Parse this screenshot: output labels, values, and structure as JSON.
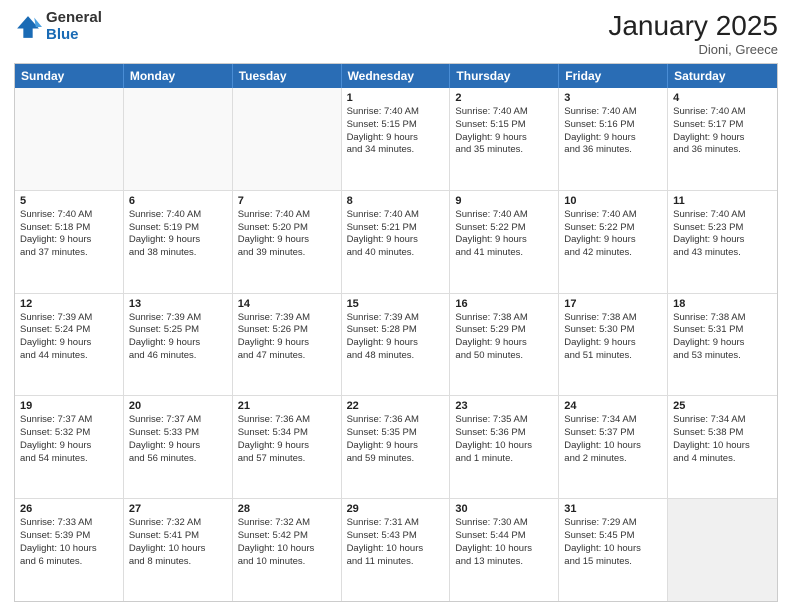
{
  "header": {
    "logo": {
      "general": "General",
      "blue": "Blue"
    },
    "title": "January 2025",
    "location": "Dioni, Greece"
  },
  "days_of_week": [
    "Sunday",
    "Monday",
    "Tuesday",
    "Wednesday",
    "Thursday",
    "Friday",
    "Saturday"
  ],
  "weeks": [
    [
      {
        "day": "",
        "info": "",
        "empty": true
      },
      {
        "day": "",
        "info": "",
        "empty": true
      },
      {
        "day": "",
        "info": "",
        "empty": true
      },
      {
        "day": "1",
        "info": "Sunrise: 7:40 AM\nSunset: 5:15 PM\nDaylight: 9 hours\nand 34 minutes."
      },
      {
        "day": "2",
        "info": "Sunrise: 7:40 AM\nSunset: 5:15 PM\nDaylight: 9 hours\nand 35 minutes."
      },
      {
        "day": "3",
        "info": "Sunrise: 7:40 AM\nSunset: 5:16 PM\nDaylight: 9 hours\nand 36 minutes."
      },
      {
        "day": "4",
        "info": "Sunrise: 7:40 AM\nSunset: 5:17 PM\nDaylight: 9 hours\nand 36 minutes."
      }
    ],
    [
      {
        "day": "5",
        "info": "Sunrise: 7:40 AM\nSunset: 5:18 PM\nDaylight: 9 hours\nand 37 minutes."
      },
      {
        "day": "6",
        "info": "Sunrise: 7:40 AM\nSunset: 5:19 PM\nDaylight: 9 hours\nand 38 minutes."
      },
      {
        "day": "7",
        "info": "Sunrise: 7:40 AM\nSunset: 5:20 PM\nDaylight: 9 hours\nand 39 minutes."
      },
      {
        "day": "8",
        "info": "Sunrise: 7:40 AM\nSunset: 5:21 PM\nDaylight: 9 hours\nand 40 minutes."
      },
      {
        "day": "9",
        "info": "Sunrise: 7:40 AM\nSunset: 5:22 PM\nDaylight: 9 hours\nand 41 minutes."
      },
      {
        "day": "10",
        "info": "Sunrise: 7:40 AM\nSunset: 5:22 PM\nDaylight: 9 hours\nand 42 minutes."
      },
      {
        "day": "11",
        "info": "Sunrise: 7:40 AM\nSunset: 5:23 PM\nDaylight: 9 hours\nand 43 minutes."
      }
    ],
    [
      {
        "day": "12",
        "info": "Sunrise: 7:39 AM\nSunset: 5:24 PM\nDaylight: 9 hours\nand 44 minutes."
      },
      {
        "day": "13",
        "info": "Sunrise: 7:39 AM\nSunset: 5:25 PM\nDaylight: 9 hours\nand 46 minutes."
      },
      {
        "day": "14",
        "info": "Sunrise: 7:39 AM\nSunset: 5:26 PM\nDaylight: 9 hours\nand 47 minutes."
      },
      {
        "day": "15",
        "info": "Sunrise: 7:39 AM\nSunset: 5:28 PM\nDaylight: 9 hours\nand 48 minutes."
      },
      {
        "day": "16",
        "info": "Sunrise: 7:38 AM\nSunset: 5:29 PM\nDaylight: 9 hours\nand 50 minutes."
      },
      {
        "day": "17",
        "info": "Sunrise: 7:38 AM\nSunset: 5:30 PM\nDaylight: 9 hours\nand 51 minutes."
      },
      {
        "day": "18",
        "info": "Sunrise: 7:38 AM\nSunset: 5:31 PM\nDaylight: 9 hours\nand 53 minutes."
      }
    ],
    [
      {
        "day": "19",
        "info": "Sunrise: 7:37 AM\nSunset: 5:32 PM\nDaylight: 9 hours\nand 54 minutes."
      },
      {
        "day": "20",
        "info": "Sunrise: 7:37 AM\nSunset: 5:33 PM\nDaylight: 9 hours\nand 56 minutes."
      },
      {
        "day": "21",
        "info": "Sunrise: 7:36 AM\nSunset: 5:34 PM\nDaylight: 9 hours\nand 57 minutes."
      },
      {
        "day": "22",
        "info": "Sunrise: 7:36 AM\nSunset: 5:35 PM\nDaylight: 9 hours\nand 59 minutes."
      },
      {
        "day": "23",
        "info": "Sunrise: 7:35 AM\nSunset: 5:36 PM\nDaylight: 10 hours\nand 1 minute."
      },
      {
        "day": "24",
        "info": "Sunrise: 7:34 AM\nSunset: 5:37 PM\nDaylight: 10 hours\nand 2 minutes."
      },
      {
        "day": "25",
        "info": "Sunrise: 7:34 AM\nSunset: 5:38 PM\nDaylight: 10 hours\nand 4 minutes."
      }
    ],
    [
      {
        "day": "26",
        "info": "Sunrise: 7:33 AM\nSunset: 5:39 PM\nDaylight: 10 hours\nand 6 minutes."
      },
      {
        "day": "27",
        "info": "Sunrise: 7:32 AM\nSunset: 5:41 PM\nDaylight: 10 hours\nand 8 minutes."
      },
      {
        "day": "28",
        "info": "Sunrise: 7:32 AM\nSunset: 5:42 PM\nDaylight: 10 hours\nand 10 minutes."
      },
      {
        "day": "29",
        "info": "Sunrise: 7:31 AM\nSunset: 5:43 PM\nDaylight: 10 hours\nand 11 minutes."
      },
      {
        "day": "30",
        "info": "Sunrise: 7:30 AM\nSunset: 5:44 PM\nDaylight: 10 hours\nand 13 minutes."
      },
      {
        "day": "31",
        "info": "Sunrise: 7:29 AM\nSunset: 5:45 PM\nDaylight: 10 hours\nand 15 minutes."
      },
      {
        "day": "",
        "info": "",
        "empty": true,
        "shaded": true
      }
    ]
  ]
}
